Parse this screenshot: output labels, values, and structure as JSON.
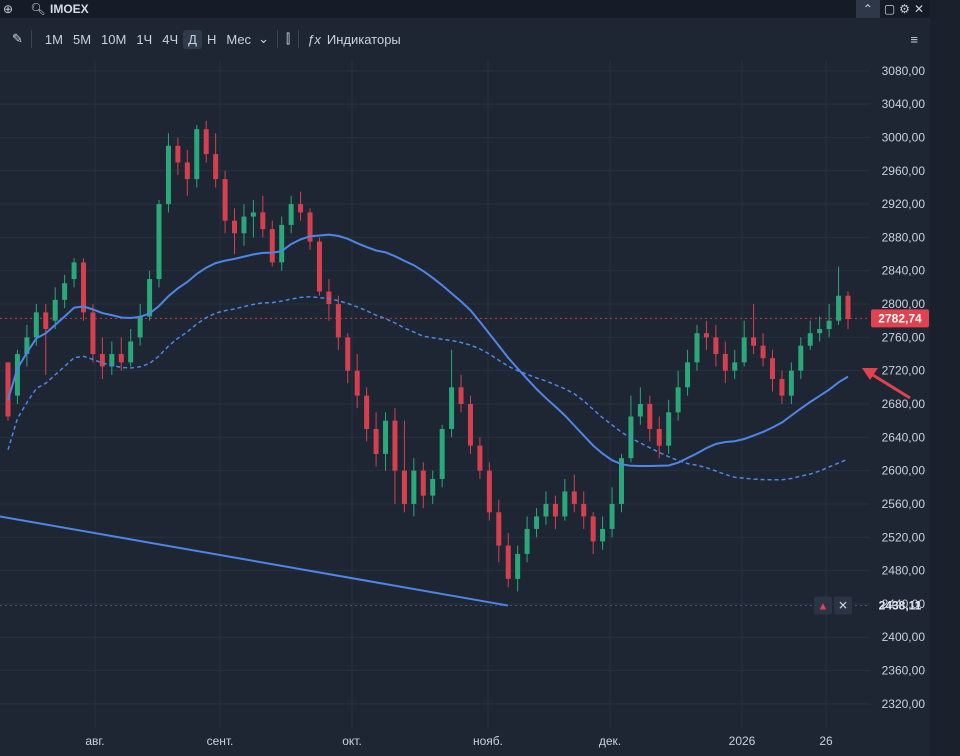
{
  "header": {
    "symbol": "IMOEX",
    "timeframes": [
      "1M",
      "5M",
      "10M",
      "1Ч",
      "4Ч",
      "Д",
      "Н",
      "Мес"
    ],
    "active_timeframe": "Д",
    "indicators_label": "Индикаторы"
  },
  "chart_data": {
    "type": "candlestick",
    "y_ticks": [
      "3080,00",
      "3040,00",
      "3000,00",
      "2960,00",
      "2920,00",
      "2880,00",
      "2840,00",
      "2800,00",
      "2760,00",
      "2720,00",
      "2680,00",
      "2640,00",
      "2600,00",
      "2560,00",
      "2520,00",
      "2480,00",
      "2440,00",
      "2400,00",
      "2360,00",
      "2320,00"
    ],
    "x_ticks": [
      "авг.",
      "сент.",
      "окт.",
      "нояб.",
      "дек.",
      "2026",
      "26"
    ],
    "ylim": [
      2303,
      3093
    ],
    "current_price_label": "2782,74",
    "current_price": 2782.74,
    "level_label": "2438,11",
    "level_price": 2438.11,
    "candle_data": [
      [
        2730,
        2665,
        2730,
        2660
      ],
      [
        2690,
        2740,
        2745,
        2680
      ],
      [
        2740,
        2760,
        2775,
        2725
      ],
      [
        2760,
        2790,
        2800,
        2750
      ],
      [
        2790,
        2770,
        2800,
        2715
      ],
      [
        2780,
        2805,
        2820,
        2770
      ],
      [
        2805,
        2825,
        2835,
        2795
      ],
      [
        2830,
        2850,
        2855,
        2820
      ],
      [
        2850,
        2790,
        2855,
        2780
      ],
      [
        2790,
        2740,
        2800,
        2730
      ],
      [
        2740,
        2725,
        2760,
        2710
      ],
      [
        2725,
        2740,
        2755,
        2715
      ],
      [
        2740,
        2730,
        2760,
        2720
      ],
      [
        2730,
        2755,
        2770,
        2725
      ],
      [
        2760,
        2785,
        2800,
        2750
      ],
      [
        2785,
        2830,
        2840,
        2780
      ],
      [
        2830,
        2920,
        2925,
        2820
      ],
      [
        2920,
        2990,
        3005,
        2910
      ],
      [
        2990,
        2970,
        3000,
        2955
      ],
      [
        2970,
        2950,
        2985,
        2930
      ],
      [
        2950,
        3010,
        3015,
        2940
      ],
      [
        3010,
        2980,
        3020,
        2970
      ],
      [
        2980,
        2950,
        3005,
        2940
      ],
      [
        2950,
        2900,
        2960,
        2885
      ],
      [
        2900,
        2885,
        2915,
        2860
      ],
      [
        2885,
        2905,
        2920,
        2870
      ],
      [
        2905,
        2910,
        2925,
        2880
      ],
      [
        2910,
        2890,
        2930,
        2880
      ],
      [
        2890,
        2850,
        2900,
        2845
      ],
      [
        2850,
        2895,
        2905,
        2840
      ],
      [
        2895,
        2920,
        2930,
        2885
      ],
      [
        2920,
        2910,
        2935,
        2900
      ],
      [
        2910,
        2875,
        2915,
        2865
      ],
      [
        2875,
        2815,
        2880,
        2810
      ],
      [
        2815,
        2800,
        2830,
        2780
      ],
      [
        2800,
        2760,
        2810,
        2745
      ],
      [
        2760,
        2720,
        2765,
        2705
      ],
      [
        2720,
        2690,
        2740,
        2675
      ],
      [
        2690,
        2650,
        2700,
        2635
      ],
      [
        2650,
        2620,
        2670,
        2605
      ],
      [
        2620,
        2660,
        2670,
        2600
      ],
      [
        2660,
        2600,
        2675,
        2560
      ],
      [
        2600,
        2560,
        2660,
        2550
      ],
      [
        2560,
        2600,
        2615,
        2545
      ],
      [
        2600,
        2570,
        2610,
        2555
      ],
      [
        2570,
        2590,
        2600,
        2560
      ],
      [
        2590,
        2650,
        2655,
        2580
      ],
      [
        2650,
        2700,
        2745,
        2640
      ],
      [
        2700,
        2680,
        2715,
        2670
      ],
      [
        2680,
        2630,
        2690,
        2620
      ],
      [
        2630,
        2600,
        2640,
        2590
      ],
      [
        2600,
        2550,
        2610,
        2540
      ],
      [
        2550,
        2510,
        2565,
        2490
      ],
      [
        2510,
        2470,
        2525,
        2460
      ],
      [
        2470,
        2500,
        2510,
        2455
      ],
      [
        2500,
        2530,
        2545,
        2490
      ],
      [
        2530,
        2545,
        2555,
        2520
      ],
      [
        2545,
        2560,
        2575,
        2535
      ],
      [
        2560,
        2545,
        2570,
        2530
      ],
      [
        2545,
        2575,
        2590,
        2540
      ],
      [
        2575,
        2560,
        2595,
        2550
      ],
      [
        2560,
        2545,
        2575,
        2530
      ],
      [
        2545,
        2515,
        2550,
        2500
      ],
      [
        2515,
        2530,
        2545,
        2505
      ],
      [
        2530,
        2560,
        2580,
        2520
      ],
      [
        2560,
        2615,
        2620,
        2550
      ],
      [
        2615,
        2665,
        2690,
        2610
      ],
      [
        2665,
        2680,
        2700,
        2655
      ],
      [
        2680,
        2650,
        2690,
        2635
      ],
      [
        2650,
        2630,
        2665,
        2615
      ],
      [
        2630,
        2670,
        2685,
        2620
      ],
      [
        2670,
        2700,
        2720,
        2660
      ],
      [
        2700,
        2730,
        2745,
        2690
      ],
      [
        2730,
        2765,
        2775,
        2720
      ],
      [
        2765,
        2760,
        2780,
        2745
      ],
      [
        2760,
        2740,
        2775,
        2725
      ],
      [
        2740,
        2720,
        2755,
        2705
      ],
      [
        2720,
        2730,
        2745,
        2710
      ],
      [
        2730,
        2760,
        2780,
        2725
      ],
      [
        2760,
        2750,
        2800,
        2740
      ],
      [
        2750,
        2735,
        2765,
        2725
      ],
      [
        2735,
        2710,
        2745,
        2695
      ],
      [
        2710,
        2690,
        2720,
        2680
      ],
      [
        2690,
        2720,
        2730,
        2680
      ],
      [
        2720,
        2750,
        2760,
        2710
      ],
      [
        2750,
        2765,
        2780,
        2745
      ],
      [
        2765,
        2770,
        2785,
        2755
      ],
      [
        2770,
        2780,
        2800,
        2760
      ],
      [
        2780,
        2810,
        2845,
        2775
      ],
      [
        2810,
        2782,
        2815,
        2770
      ]
    ]
  }
}
